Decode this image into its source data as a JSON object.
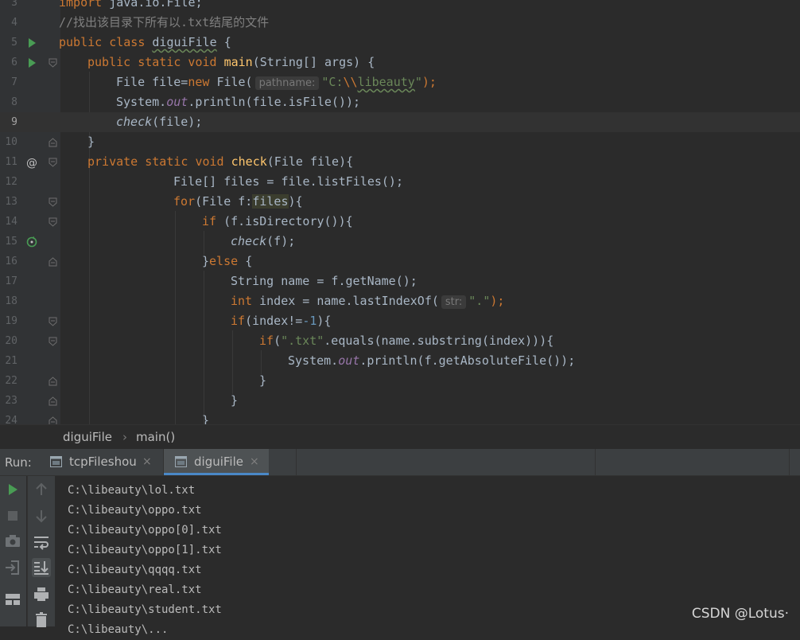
{
  "editor": {
    "line_numbers": [
      "3",
      "4",
      "5",
      "6",
      "7",
      "8",
      "9",
      "10",
      "11",
      "12",
      "13",
      "14",
      "15",
      "16",
      "17",
      "18",
      "19",
      "20",
      "21",
      "22",
      "23",
      "24"
    ],
    "tokens": {
      "l3_import": "import ",
      "l3_rest": "java.io.File;",
      "l4_comment": "//找出该目录下所有以.txt结尾的文件",
      "l5_kw": "public class ",
      "l5_name": "diguiFile",
      "l5_rest": " {",
      "l6_kw": "public static void ",
      "l6_fn": "main",
      "l6_rest": "(String[] args) {",
      "l7_a": "File file=",
      "l7_new": "new ",
      "l7_b": "File(",
      "l7_hint": "pathname:",
      "l7_q": "\"C:",
      "l7_esc": "\\\\",
      "l7_str": "libeauty",
      "l7_q2": "\"",
      "l7_end": ");",
      "l8_a": "System.",
      "l8_out": "out",
      "l8_b": ".println(file.isFile());",
      "l9_fn": "check",
      "l9_rest": "(file);",
      "l10": "}",
      "l11_kw": "private static void ",
      "l11_fn": "check",
      "l11_rest": "(File file){",
      "l12": "File[] files = file.listFiles();",
      "l13_kw": "for",
      "l13_a": "(File f:",
      "l13_hl": "files",
      "l13_b": "){",
      "l14_kw": "if ",
      "l14_rest": "(f.isDirectory()){",
      "l15_fn": "check",
      "l15_rest": "(f);",
      "l16_a": "}",
      "l16_kw": "else ",
      "l16_b": "{",
      "l17": "String name = f.getName();",
      "l18_kw": "int ",
      "l18_a": "index = name.lastIndexOf(",
      "l18_hint": "str:",
      "l18_str": "\".\"",
      "l18_end": ");",
      "l19_kw": "if",
      "l19_a": "(index!=",
      "l19_num": "-1",
      "l19_b": "){",
      "l20_kw": "if",
      "l20_a": "(",
      "l20_str": "\".txt\"",
      "l20_b": ".equals(name.substring(index))){",
      "l21_a": "System.",
      "l21_out": "out",
      "l21_b": ".println(f.getAbsoluteFile());",
      "l22": "}",
      "l23": "}",
      "l24": "}"
    }
  },
  "breadcrumb": {
    "class_name": "diguiFile",
    "separator": "›",
    "method": "main()"
  },
  "run_panel": {
    "label": "Run:",
    "tabs": [
      {
        "label": "tcpFileshou",
        "close": "×"
      },
      {
        "label": "diguiFile",
        "close": "×"
      }
    ]
  },
  "console": {
    "lines": [
      "C:\\libeauty\\lol.txt",
      "C:\\libeauty\\oppo.txt",
      "C:\\libeauty\\oppo[0].txt",
      "C:\\libeauty\\oppo[1].txt",
      "C:\\libeauty\\qqqq.txt",
      "C:\\libeauty\\real.txt",
      "C:\\libeauty\\student.txt",
      "C:\\libeauty\\..."
    ]
  },
  "watermark": "CSDN @Lotus·",
  "colors": {
    "keyword": "#cc7832",
    "string": "#6a8759",
    "number": "#6897bb",
    "method": "#ffc66d",
    "field": "#9876aa",
    "comment": "#808080",
    "accent": "#4a88c7"
  }
}
